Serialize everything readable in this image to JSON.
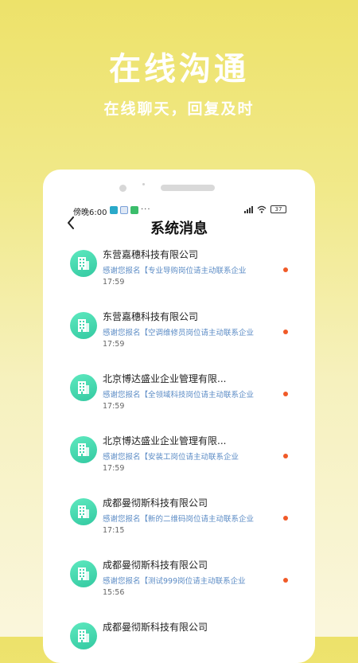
{
  "promo": {
    "title": "在线沟通",
    "subtitle": "在线聊天，回复及时"
  },
  "status_bar": {
    "time": "傍晚6:00",
    "dots": "···",
    "battery": "37"
  },
  "page": {
    "title": "系统消息",
    "back_icon": "chevron-left-icon"
  },
  "colors": {
    "avatar": "#3fd4ad",
    "unread_dot": "#f05a28",
    "preview_text": "#5b8bc5"
  },
  "messages": [
    {
      "company": "东营嘉穗科技有限公司",
      "preview": "感谢您报名【专业导购岗位请主动联系企业",
      "time": "17:59"
    },
    {
      "company": "东营嘉穗科技有限公司",
      "preview": "感谢您报名【空调维修员岗位请主动联系企业",
      "time": "17:59"
    },
    {
      "company": "北京博达盛业企业管理有限...",
      "preview": "感谢您报名【全领域科技岗位请主动联系企业",
      "time": "17:59"
    },
    {
      "company": "北京博达盛业企业管理有限...",
      "preview": "感谢您报名【安装工岗位请主动联系企业",
      "time": "17:59"
    },
    {
      "company": "成都曼彻斯科技有限公司",
      "preview": "感谢您报名【新的二维码岗位请主动联系企业",
      "time": "17:15"
    },
    {
      "company": "成都曼彻斯科技有限公司",
      "preview": "感谢您报名【测试999岗位请主动联系企业",
      "time": "15:56"
    },
    {
      "company": "成都曼彻斯科技有限公司",
      "preview": "",
      "time": ""
    }
  ]
}
